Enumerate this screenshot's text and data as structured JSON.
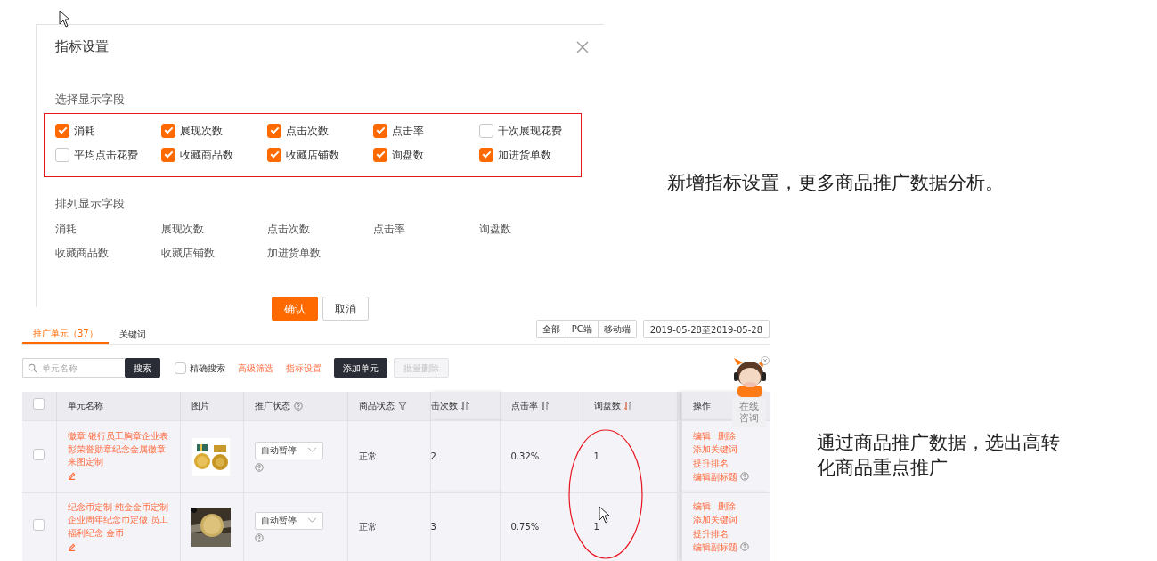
{
  "settings_dialog": {
    "title": "指标设置",
    "select_section": {
      "title": "选择显示字段",
      "fields": [
        {
          "label": "消耗",
          "checked": true
        },
        {
          "label": "展现次数",
          "checked": true
        },
        {
          "label": "点击次数",
          "checked": true
        },
        {
          "label": "点击率",
          "checked": true
        },
        {
          "label": "千次展现花费",
          "checked": false
        },
        {
          "label": "平均点击花费",
          "checked": false
        },
        {
          "label": "收藏商品数",
          "checked": true
        },
        {
          "label": "收藏店铺数",
          "checked": true
        },
        {
          "label": "询盘数",
          "checked": true
        },
        {
          "label": "加进货单数",
          "checked": true
        }
      ]
    },
    "order_section": {
      "title": "排列显示字段",
      "fields": [
        "消耗",
        "展现次数",
        "点击次数",
        "点击率",
        "询盘数",
        "收藏商品数",
        "收藏店铺数",
        "加进货单数"
      ]
    },
    "buttons": [
      {
        "label": "确认",
        "kind": "primary"
      },
      {
        "label": "取消",
        "kind": "default"
      }
    ]
  },
  "annotations": [
    "新增指标设置，更多商品推广数据分析。",
    "通过商品推广数据，选出高转化商品重点推广"
  ],
  "promotion_panel": {
    "tabs": [
      {
        "label": "推广单元（37）",
        "selected": true
      },
      {
        "label": "关键词",
        "selected": false
      }
    ],
    "terminal_filters": [
      "全部",
      "PC端",
      "移动端"
    ],
    "date_range": "2019-05-28至2019-05-28",
    "search": {
      "placeholder": "单元名称",
      "button": "搜索"
    },
    "exact_search": {
      "label": "精确搜索",
      "checked": false
    },
    "links": [
      "高级筛选",
      "指标设置"
    ],
    "buttons": [
      {
        "label": "添加单元",
        "disabled": false
      },
      {
        "label": "批量删除",
        "disabled": true
      }
    ],
    "chat_widget": {
      "label": "在线咨询"
    },
    "table": {
      "select_all_checked": false,
      "columns": [
        {
          "kind": "checkbox"
        },
        {
          "label": "单元名称",
          "kind": "plain"
        },
        {
          "label": "图片",
          "kind": "plain"
        },
        {
          "label": "推广状态",
          "kind": "help"
        },
        {
          "label": "商品状态",
          "kind": "filter"
        },
        {
          "label": "击次数",
          "kind": "sort",
          "sorted": false
        },
        {
          "label": "点击率",
          "kind": "sort",
          "sorted": false
        },
        {
          "label": "询盘数",
          "kind": "sort",
          "sorted": true
        },
        {
          "kind": "gap"
        },
        {
          "label": "操作",
          "kind": "plain"
        }
      ],
      "rows": [
        {
          "checked": false,
          "title": "徽章 银行员工胸章企业表彰荣誉勋章纪念金属徽章来图定制",
          "status": "自动暂停",
          "product_status": "正常",
          "clicks": "2",
          "click_rate": "0.32%",
          "inquiries": "1",
          "actions": [
            "编辑",
            "删除",
            "添加关键词",
            "提升排名",
            "编辑副标题"
          ]
        },
        {
          "checked": false,
          "title": "纪念币定制 纯金金币定制企业周年纪念币定做 员工福利纪念 金币",
          "status": "自动暂停",
          "product_status": "正常",
          "clicks": "3",
          "click_rate": "0.75%",
          "inquiries": "1",
          "actions": [
            "编辑",
            "删除",
            "添加关键词",
            "提升排名",
            "编辑副标题"
          ]
        }
      ]
    }
  }
}
